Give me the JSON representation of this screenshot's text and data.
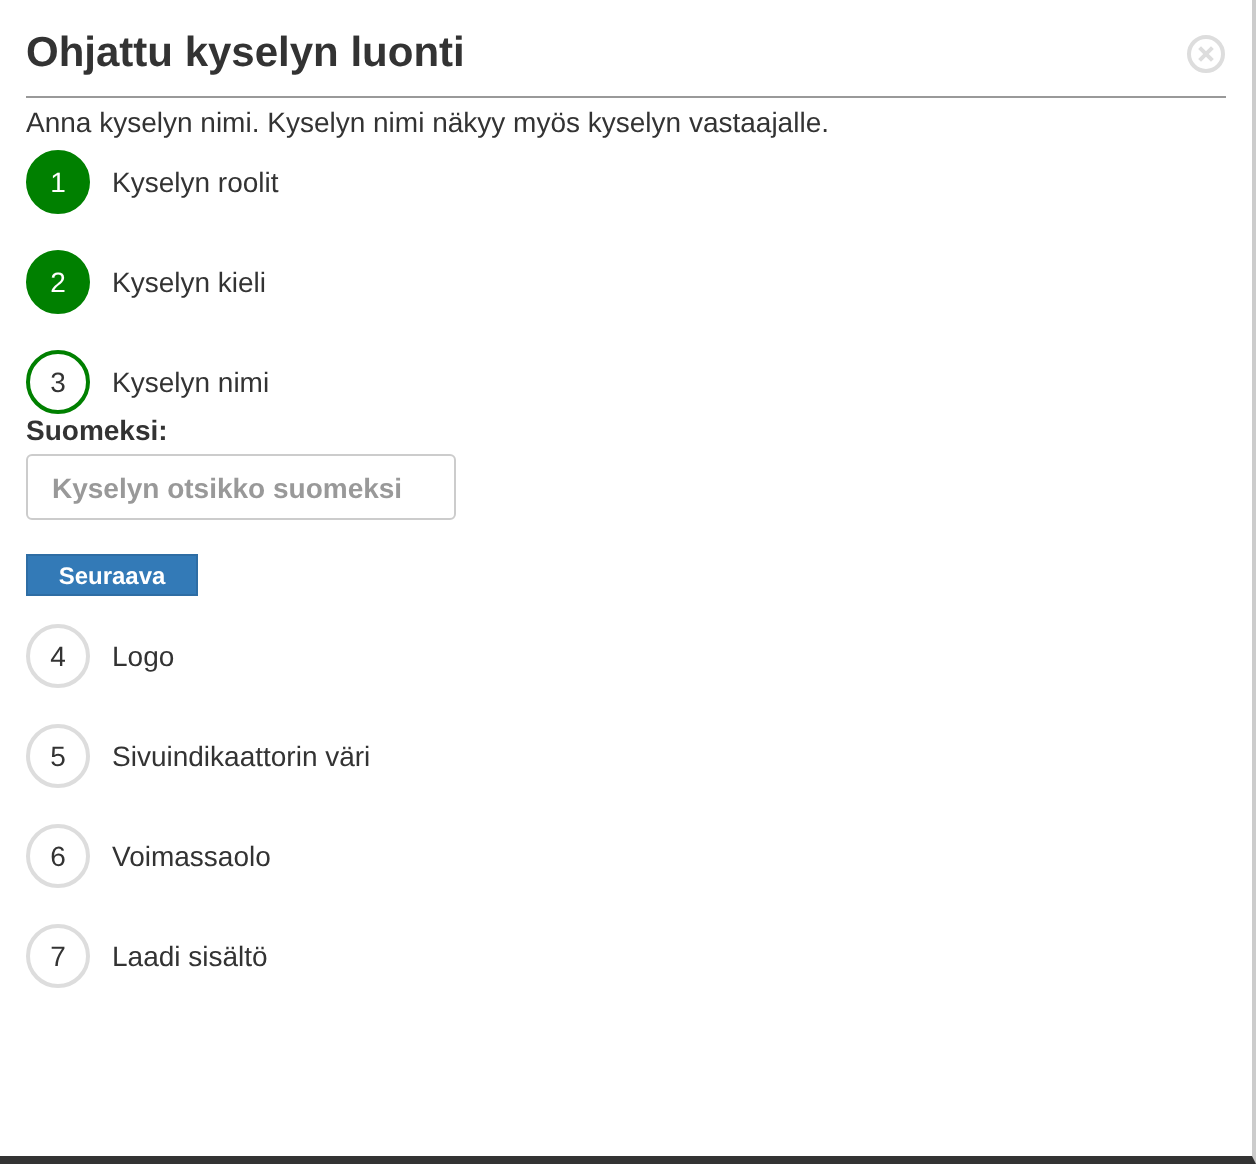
{
  "dialog": {
    "title": "Ohjattu kyselyn luonti",
    "intro": "Anna kyselyn nimi. Kyselyn nimi näkyy myös kyselyn vastaajalle."
  },
  "steps": [
    {
      "number": "1",
      "label": "Kyselyn roolit",
      "completed": true,
      "selected": false
    },
    {
      "number": "2",
      "label": "Kyselyn kieli",
      "completed": true,
      "selected": false
    },
    {
      "number": "3",
      "label": "Kyselyn nimi",
      "completed": false,
      "selected": true
    },
    {
      "number": "4",
      "label": "Logo",
      "completed": false,
      "selected": false
    },
    {
      "number": "5",
      "label": "Sivuindikaattorin väri",
      "completed": false,
      "selected": false
    },
    {
      "number": "6",
      "label": "Voimassaolo",
      "completed": false,
      "selected": false
    },
    {
      "number": "7",
      "label": "Laadi sisältö",
      "completed": false,
      "selected": false
    }
  ],
  "form": {
    "field_label": "Suomeksi:",
    "placeholder": "Kyselyn otsikko suomeksi",
    "next_button": "Seuraava"
  }
}
